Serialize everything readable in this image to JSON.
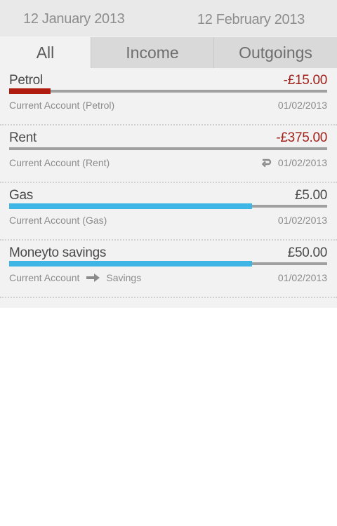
{
  "header": {
    "date_start": "12 January 2013",
    "date_end": "12 February 2013"
  },
  "tabs": [
    {
      "label": "All",
      "active": true
    },
    {
      "label": "Income",
      "active": false
    },
    {
      "label": "Outgoings",
      "active": false
    }
  ],
  "colors": {
    "outgoing": "#b01d0e",
    "income": "#3fb7e6",
    "amount_negative": "#a0211a",
    "amount_positive": "#4a4a4a"
  },
  "transactions": [
    {
      "name": "Petrol",
      "amount": "-£15.00",
      "progress_fraction": 0.13,
      "type": "outgoing",
      "account": "Current Account (Petrol)",
      "date": "01/02/2013"
    },
    {
      "name": "Rent",
      "amount": "-£375.00",
      "progress_fraction": 0.0,
      "type": "outgoing",
      "account": "Current Account (Rent)",
      "icon": "repeat-icon",
      "date": "01/02/2013"
    },
    {
      "name": "Gas",
      "amount": "£5.00",
      "progress_fraction": 0.763,
      "type": "income",
      "account": "Current Account (Gas)",
      "date": "01/02/2013"
    },
    {
      "name": "Moneyto savings",
      "amount": "£50.00",
      "progress_fraction": 0.763,
      "type": "income",
      "account_from": "Current Account",
      "account_to": "Savings",
      "icon": "arrow-right-icon",
      "date": "01/02/2013"
    }
  ]
}
